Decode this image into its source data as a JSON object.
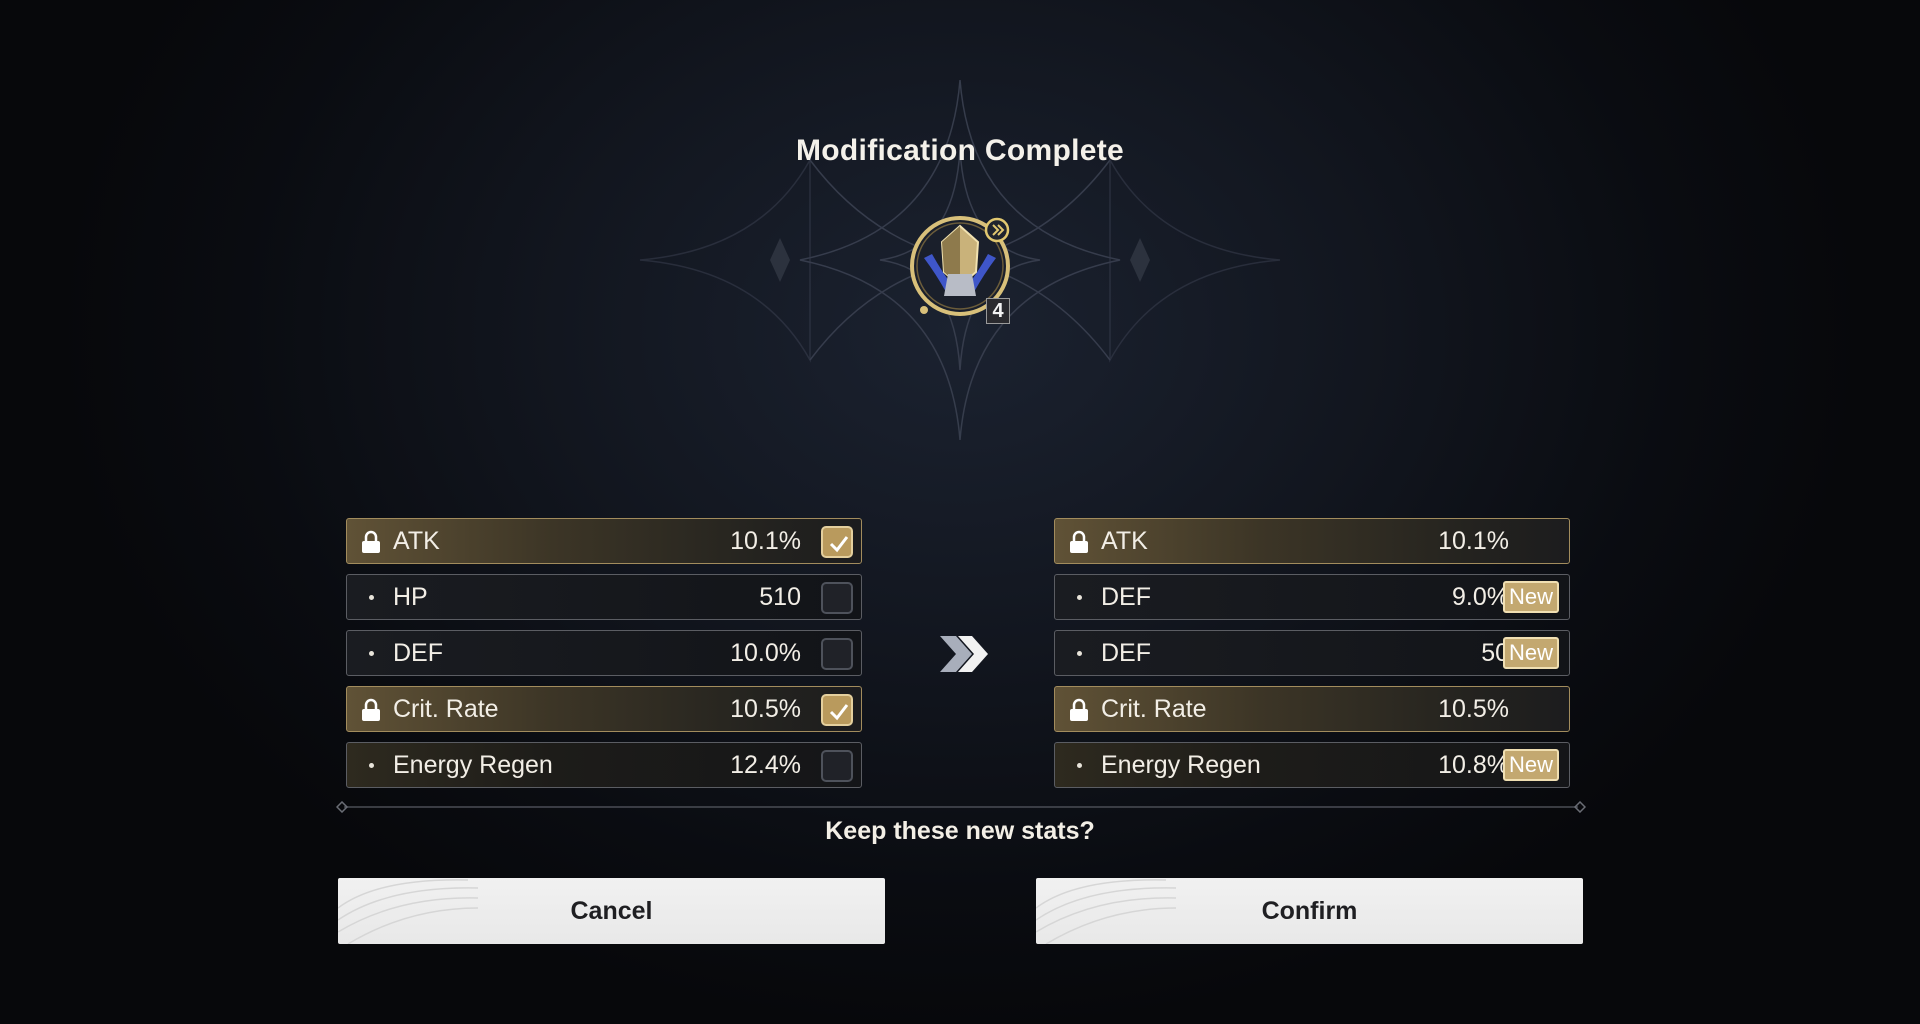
{
  "dialog": {
    "title": "Modification Complete",
    "emblem": {
      "icon": "echo-crest-icon",
      "level": "4"
    },
    "prompt": "Keep these new stats?",
    "cancel_label": "Cancel",
    "confirm_label": "Confirm"
  },
  "current_stats": [
    {
      "name": "ATK",
      "value": "10.1%",
      "locked": true,
      "checked": true
    },
    {
      "name": "HP",
      "value": "510",
      "locked": false,
      "checked": false
    },
    {
      "name": "DEF",
      "value": "10.0%",
      "locked": false,
      "checked": false
    },
    {
      "name": "Crit. Rate",
      "value": "10.5%",
      "locked": true,
      "checked": true
    },
    {
      "name": "Energy Regen",
      "value": "12.4%",
      "locked": false,
      "checked": false
    }
  ],
  "new_stats": [
    {
      "name": "ATK",
      "value": "10.1%",
      "locked": true,
      "is_new": false
    },
    {
      "name": "DEF",
      "value": "9.0%",
      "locked": false,
      "is_new": true
    },
    {
      "name": "DEF",
      "value": "50",
      "locked": false,
      "is_new": true
    },
    {
      "name": "Crit. Rate",
      "value": "10.5%",
      "locked": true,
      "is_new": false
    },
    {
      "name": "Energy Regen",
      "value": "10.8%",
      "locked": false,
      "is_new": true
    }
  ],
  "new_badge_label": "New",
  "colors": {
    "gold_accent": "#c3a870",
    "locked_border": "#a28c5d",
    "background": "#12161f"
  }
}
